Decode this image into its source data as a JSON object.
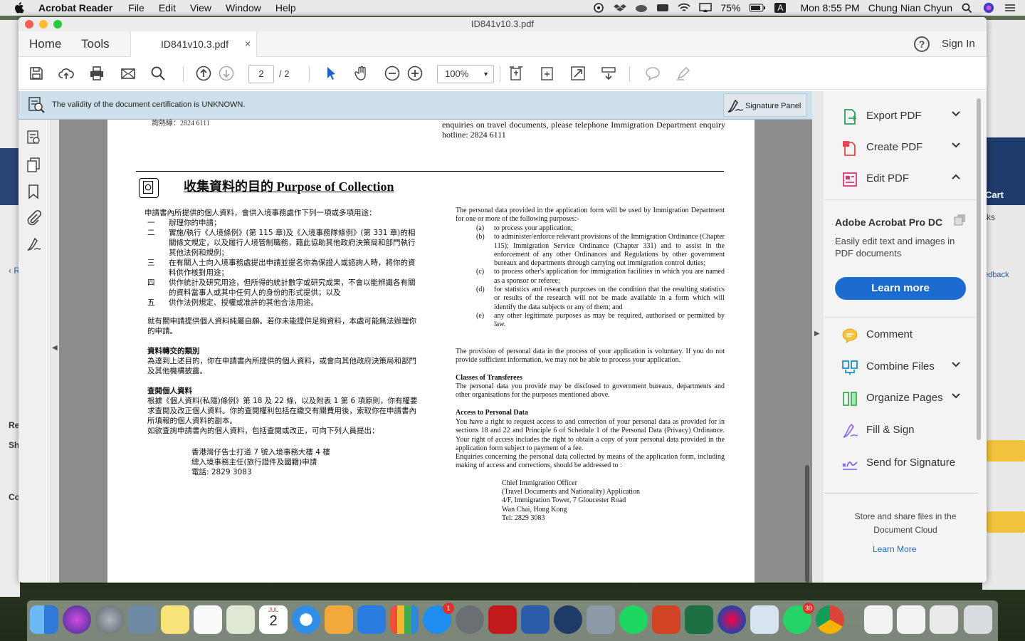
{
  "menubar": {
    "app_name": "Acrobat Reader",
    "menus": [
      "File",
      "Edit",
      "View",
      "Window",
      "Help"
    ],
    "battery": "75%",
    "input_source": "A",
    "clock": "Mon 8:55 PM",
    "user": "Chung Nian Chyun"
  },
  "window": {
    "title": "ID841v10.3.pdf",
    "tab_home": "Home",
    "tab_tools": "Tools",
    "doc_tab": "ID841v10.3.pdf",
    "doc_tab_close": "×",
    "help": "?",
    "sign_in": "Sign In"
  },
  "toolbar": {
    "page_current": "2",
    "page_total": "/ 2",
    "zoom": "100%"
  },
  "sigbar": {
    "message": "The validity of the document certification is UNKNOWN.",
    "button": "Signature Panel"
  },
  "document": {
    "top_cut": "詢熱線：2824 6111",
    "top_fragment": "enquiries on travel documents, please telephone Immigration Department enquiry hotline: 2824 6111",
    "heading": "收集資料的目的  Purpose of Collection",
    "zh": {
      "intro": "申請書內所提供的個人資料，會供入境事務處作下列一項或多項用途：",
      "items": [
        {
          "n": "一",
          "t": "辦理你的申請；"
        },
        {
          "n": "二",
          "t": "實施/執行《人境條例》(第 115 章)及《入境事務隊條例》(第 331 章)的相關條文規定，以及履行人境管制職務，藉此協助其他政府決策局和部門執行其他法例和規例；"
        },
        {
          "n": "三",
          "t": "在有關人士向入境事務處提出申請並提名你為保證人或諮詢人時，將你的資料供作核對用途；"
        },
        {
          "n": "四",
          "t": "供作統計及研究用途，但所得的統計數字或研究成果，不會以能辨識各有關的資料當事人或其中任何人的身份的形式提供；以及"
        },
        {
          "n": "五",
          "t": "供作法例規定、授權或准許的其他合法用途。"
        }
      ],
      "voluntary": "就有關申請提供個人資料純屬自願。若你未能提供足夠資料，本處可能無法辦理你的申請。",
      "transferees_title": "資料轉交的類別",
      "transferees": "為達到上述目的，你在申請書內所提供的個人資料，或會向其他政府決策局和部門及其他機構披露。",
      "access_title": "查閱個人資料",
      "access": "根據《個人資料(私隱)條例》第 18 及 22 條，以及附表 1 第 6 項原則，你有權要求查閱及改正個人資料。你的查閱權利包括在繳交有關費用後，索取你在申請書內所填報的個人資料的副本。",
      "enquiry": "如欲查詢申請書內的個人資料，包括查閱或改正，可向下列人員提出：",
      "addr1": "香港灣仔告士打道 7 號入境事務大樓 4 樓",
      "addr2": "總入境事務主任(旅行證件及國籍)申請",
      "addr3": "電話: 2829 3083"
    },
    "en": {
      "intro": "The personal data provided in the application form will be used by Immigration Department for one or more of the following purposes:-",
      "items": [
        {
          "n": "(a)",
          "t": "to process your application;"
        },
        {
          "n": "(b)",
          "t": "to administer/enforce relevant provisions of the Immigration Ordinance (Chapter 115); Immigration Service Ordinance (Chapter 331) and to assist in the enforcement of any other Ordinances and Regulations by other government bureaux and departments through carrying out immigration control duties;"
        },
        {
          "n": "(c)",
          "t": "to process other's application for immigration facilities in which you are named as a sponsor or referee;"
        },
        {
          "n": "(d)",
          "t": "for statistics and research purposes on the condition that the resulting statistics or results of the research will not be made available in a form which will identify the data subjects or any of them; and"
        },
        {
          "n": "(e)",
          "t": "any other legitimate purposes as may be required, authorised or permitted by law."
        }
      ],
      "voluntary": "The provision of personal data in the process of your application is voluntary.   If you do not provide sufficient information, we may not be able to process your application.",
      "transferees_title": "Classes of Transferees",
      "transferees": "The personal data you provide may be disclosed to government bureaux, departments and other organisations for the purposes mentioned above.",
      "access_title": "Access to Personal Data",
      "access": "You have a right to request access to and correction of your personal data as provided for in sections 18 and 22 and Principle 6 of Schedule 1 of the Personal Data (Privacy) Ordinance.   Your right of access includes the right to obtain a copy of your personal data provided in the application form subject to payment of a fee.",
      "enquiry": "Enquiries concerning the personal data collected by means of the application form, including making of access and corrections, should be addressed to :",
      "addr1": "Chief Immigration Officer",
      "addr2": "(Travel Documents and Nationality) Application",
      "addr3": "4/F, Immigration Tower, 7 Gloucester Road",
      "addr4": "Wan Chai, Hong Kong",
      "addr5": "Tel: 2829 3083"
    }
  },
  "right_panel": {
    "export_pdf": "Export PDF",
    "create_pdf": "Create PDF",
    "edit_pdf": "Edit PDF",
    "promo_title": "Adobe Acrobat Pro DC",
    "promo_text": "Easily edit text and images in PDF documents",
    "learn_more_btn": "Learn more",
    "comment": "Comment",
    "combine_files": "Combine Files",
    "organize_pages": "Organize Pages",
    "fill_sign": "Fill & Sign",
    "send_signature": "Send for Signature",
    "store_text": "Store and share files in the Document Cloud",
    "learn_more_link": "Learn More"
  },
  "background": {
    "cart": "Cart",
    "ks": "ks",
    "feedback": "edback",
    "left_labels": [
      "‹ R",
      "Re",
      "Sh",
      "Co"
    ]
  },
  "dock": {
    "calendar_month": "JUL",
    "calendar_day": "2",
    "appstore_badge": "1",
    "whatsapp_badge": "30"
  }
}
